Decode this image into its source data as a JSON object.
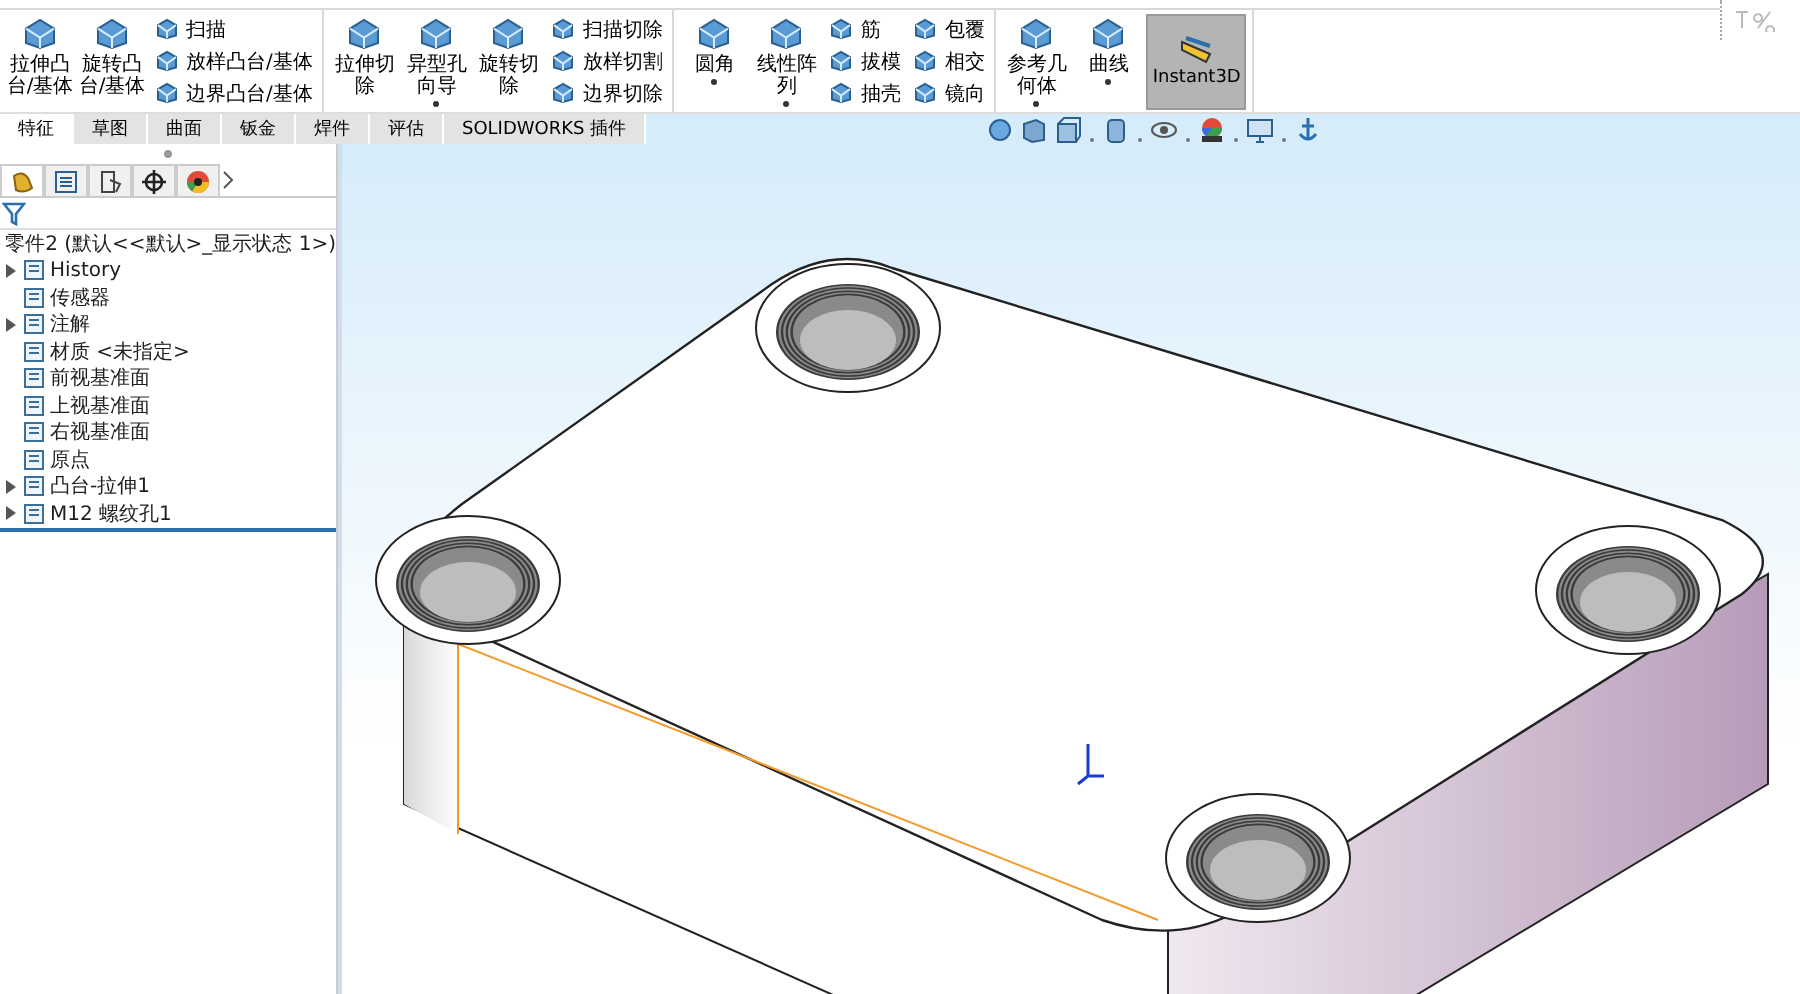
{
  "ribbon": {
    "groups": [
      {
        "large": [
          {
            "label": "拉伸凸台/基体",
            "dropdown": false,
            "selected": false
          },
          {
            "label": "旋转凸台/基体",
            "dropdown": false,
            "selected": false
          }
        ],
        "columns": [
          [
            "扫描",
            "放样凸台/基体",
            "边界凸台/基体"
          ]
        ]
      },
      {
        "large": [
          {
            "label": "拉伸切除",
            "dropdown": false,
            "selected": false
          },
          {
            "label": "异型孔向导",
            "dropdown": true,
            "selected": false
          },
          {
            "label": "旋转切除",
            "dropdown": false,
            "selected": false
          }
        ],
        "columns": [
          [
            "扫描切除",
            "放样切割",
            "边界切除"
          ]
        ]
      },
      {
        "large": [
          {
            "label": "圆角",
            "dropdown": true,
            "selected": false
          },
          {
            "label": "线性阵列",
            "dropdown": true,
            "selected": false
          }
        ],
        "columns": [
          [
            "筋",
            "拔模",
            "抽壳"
          ],
          [
            "包覆",
            "相交",
            "镜向"
          ]
        ]
      },
      {
        "large": [
          {
            "label": "参考几何体",
            "dropdown": true,
            "selected": false
          },
          {
            "label": "曲线",
            "dropdown": true,
            "selected": false
          },
          {
            "label": "Instant3D",
            "dropdown": false,
            "selected": true
          }
        ]
      }
    ]
  },
  "tabs": [
    {
      "label": "特征",
      "selected": true
    },
    {
      "label": "草图",
      "selected": false
    },
    {
      "label": "曲面",
      "selected": false
    },
    {
      "label": "钣金",
      "selected": false
    },
    {
      "label": "焊件",
      "selected": false
    },
    {
      "label": "评估",
      "selected": false
    },
    {
      "label": "SOLIDWORKS 插件",
      "selected": false
    }
  ],
  "panel_tabs": [
    {
      "selected": true
    },
    {
      "selected": false
    },
    {
      "selected": false
    },
    {
      "selected": false
    },
    {
      "selected": false
    }
  ],
  "tree": {
    "label": "零件2 (默认<<默认>_显示状态 1>)",
    "children": [
      {
        "label": "History",
        "collapsible": true
      },
      {
        "label": "传感器",
        "collapsible": false
      },
      {
        "label": "注解",
        "collapsible": true
      },
      {
        "label": "材质 <未指定>",
        "collapsible": false
      },
      {
        "label": "前视基准面",
        "collapsible": false
      },
      {
        "label": "上视基准面",
        "collapsible": false
      },
      {
        "label": "右视基准面",
        "collapsible": false
      },
      {
        "label": "原点",
        "collapsible": false
      },
      {
        "label": "凸台-拉伸1",
        "collapsible": true
      },
      {
        "label": "M12 螺纹孔1",
        "collapsible": true
      }
    ]
  }
}
